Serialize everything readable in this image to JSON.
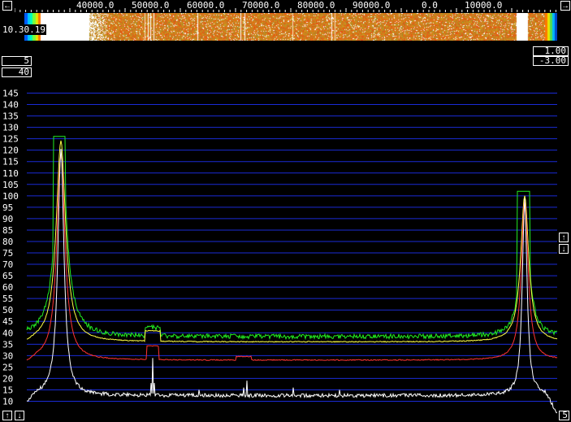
{
  "frequency_labels": [
    "40000.0",
    "50000.0",
    "60000.0",
    "70000.0",
    "80000.0",
    "90000.0",
    "0.0",
    "10000.0"
  ],
  "time_label": "10.30.19",
  "fields": {
    "left_top": "5",
    "left_bottom": "40",
    "right_top": "1.00",
    "right_bottom": "-3.00",
    "corner_bottom_right": "5"
  },
  "buttons": {
    "left": "←",
    "right": "→",
    "up": "↑",
    "down": "↓"
  },
  "colors": {
    "background": "#000000",
    "gridline": "#1a2bd6",
    "curve_max": "#22ee22",
    "curve_avg": "#ffff44",
    "curve_min": "#ff3333",
    "curve_current": "#ffffff"
  },
  "chart_data": {
    "type": "line",
    "y_ticks": [
      10,
      15,
      20,
      25,
      30,
      35,
      40,
      45,
      50,
      55,
      60,
      65,
      70,
      75,
      80,
      85,
      90,
      95,
      100,
      105,
      110,
      115,
      120,
      125,
      130,
      135,
      140,
      145
    ],
    "ylim": [
      5,
      148
    ],
    "grid": true
  }
}
